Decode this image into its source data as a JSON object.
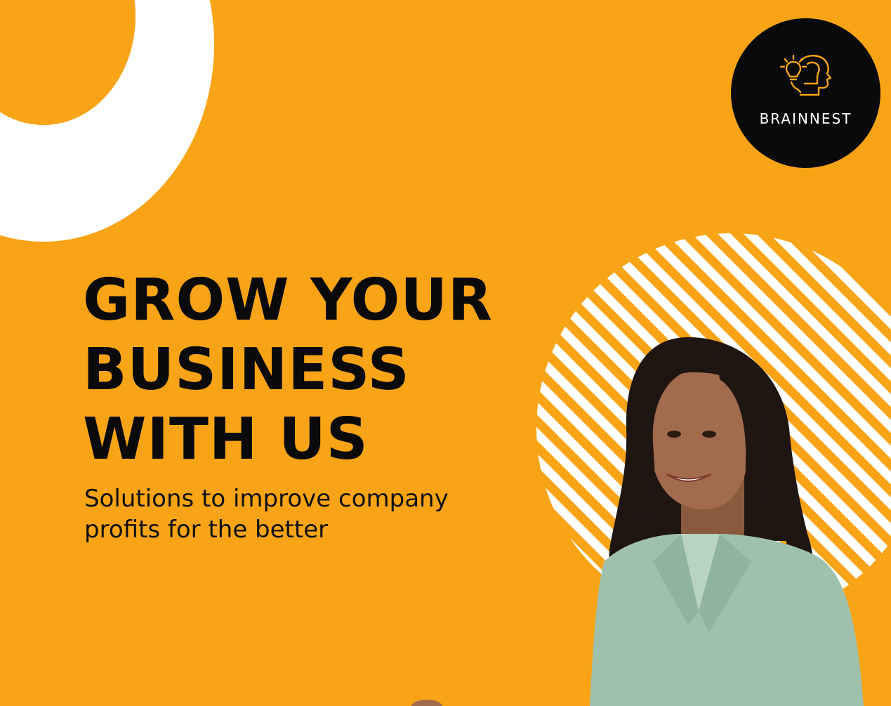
{
  "brand": {
    "name": "BRAINNEST",
    "logo_icon": "lightbulb-head-icon"
  },
  "hero": {
    "headline_lines": [
      "GROW YOUR",
      "BUSINESS",
      "WITH US"
    ],
    "subtitle_lines": [
      "Solutions to improve company",
      "profits for the better"
    ]
  },
  "colors": {
    "background": "#F8A416",
    "text": "#0A0A0A",
    "logo_bg": "#0A0A0A",
    "logo_accent": "#F8A416",
    "decoration": "#FFFFFF"
  },
  "images": {
    "photo": "smiling-woman-photo"
  }
}
